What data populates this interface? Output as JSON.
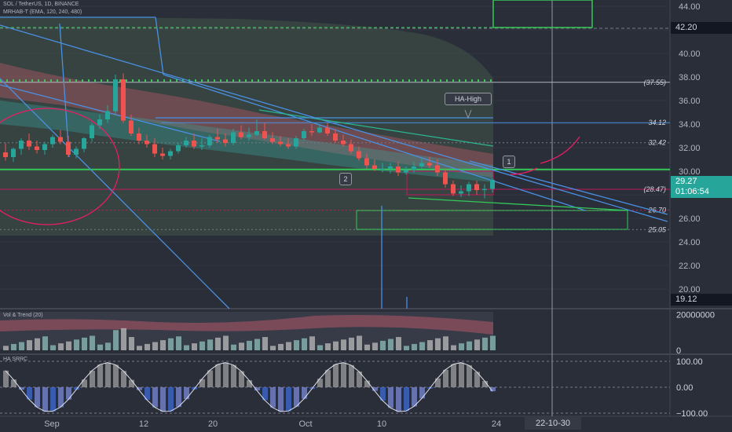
{
  "header": {
    "symbol_line": "SOL / TetherUS, 1D, BINANCE",
    "indicator_line": "MRHAB-T (EMA, 120, 240, 480)"
  },
  "panes": {
    "volume_label": "Vol & Trend (20)",
    "oscillator_label": "HA SRRC"
  },
  "price_labels": {
    "top": "42.20",
    "current_price": "29.27",
    "countdown": "01:06:54",
    "bottom": "19.12"
  },
  "annotations": {
    "ha_high": "HA-High",
    "badge_1": "1",
    "badge_2": "2"
  },
  "crosshair_date": "22-10-30",
  "colors": {
    "background": "#2a2e39",
    "up": "#26a69a",
    "down": "#ef5350",
    "trendline": "#4a90e2",
    "support": "#34c759",
    "crosshair": "#9598a1"
  },
  "chart_data": [
    {
      "type": "line",
      "pane": "price",
      "ylim": [
        18.5,
        44.8
      ],
      "y_ticks": [
        44,
        42,
        40,
        38,
        36,
        34,
        32,
        30,
        28,
        26,
        24,
        22,
        20
      ],
      "x_ticks": [
        "Sep",
        "12",
        "20",
        "Oct",
        "10",
        "24"
      ],
      "level_labels": [
        {
          "value": 37.55,
          "text": "(37.55)"
        },
        {
          "value": 34.12,
          "text": "34.12"
        },
        {
          "value": 32.42,
          "text": "32.42"
        },
        {
          "value": 28.47,
          "text": "(28.47)"
        },
        {
          "value": 26.7,
          "text": "26.70"
        },
        {
          "value": 25.05,
          "text": "25.05"
        }
      ],
      "candles": {
        "dates": [
          "Aug 29",
          "Aug 30",
          "Aug 31",
          "Sep 1",
          "Sep 2",
          "Sep 3",
          "Sep 4",
          "Sep 5",
          "Sep 6",
          "Sep 7",
          "Sep 8",
          "Sep 9",
          "Sep 10",
          "Sep 11",
          "Sep 12",
          "Sep 13",
          "Sep 14",
          "Sep 15",
          "Sep 16",
          "Sep 17",
          "Sep 18",
          "Sep 19",
          "Sep 20",
          "Sep 21",
          "Sep 22",
          "Sep 23",
          "Sep 24",
          "Sep 25",
          "Sep 26",
          "Sep 27",
          "Sep 28",
          "Sep 29",
          "Sep 30",
          "Oct 1",
          "Oct 2",
          "Oct 3",
          "Oct 4",
          "Oct 5",
          "Oct 6",
          "Oct 7",
          "Oct 8",
          "Oct 9",
          "Oct 10",
          "Oct 11",
          "Oct 12",
          "Oct 13",
          "Oct 14",
          "Oct 15",
          "Oct 16",
          "Oct 17",
          "Oct 18",
          "Oct 19",
          "Oct 20",
          "Oct 21",
          "Oct 22",
          "Oct 23",
          "Oct 24",
          "Oct 25",
          "Oct 26",
          "Oct 27",
          "Oct 28",
          "Oct 29",
          "Oct 30"
        ],
        "open": [
          31.6,
          31.2,
          31.9,
          32.6,
          32.1,
          31.8,
          32.3,
          32.9,
          32.5,
          31.4,
          31.9,
          32.8,
          33.9,
          34.4,
          35.1,
          37.8,
          34.3,
          33.2,
          32.6,
          32.3,
          31.5,
          31.3,
          31.7,
          32.2,
          32.6,
          32.1,
          32.2,
          32.9,
          32.7,
          32.4,
          33.3,
          32.9,
          33.1,
          33.4,
          32.8,
          32.5,
          32.3,
          32.1,
          32.8,
          33.4,
          33.3,
          33.7,
          33.2,
          32.6,
          32.3,
          31.7,
          31.1,
          30.5,
          30.2,
          30.2,
          30.4,
          29.9,
          30.1,
          30.4,
          30.7,
          30.5,
          29.9,
          28.9,
          28.1,
          28.3,
          28.9,
          28.4,
          28.5
        ],
        "high": [
          32.4,
          32.0,
          32.8,
          33.2,
          32.6,
          32.5,
          33.1,
          33.5,
          33.0,
          32.1,
          32.9,
          34.1,
          34.8,
          35.6,
          38.2,
          38.3,
          34.8,
          33.7,
          33.1,
          32.8,
          32.0,
          31.9,
          32.4,
          32.9,
          33.2,
          32.8,
          33.1,
          33.6,
          33.2,
          33.6,
          33.9,
          33.7,
          34.4,
          34.1,
          33.3,
          33.0,
          32.8,
          33.0,
          33.6,
          34.0,
          34.0,
          34.1,
          33.6,
          33.1,
          32.7,
          32.1,
          31.5,
          31.0,
          30.7,
          30.7,
          30.8,
          30.4,
          30.8,
          31.1,
          31.2,
          31.0,
          30.2,
          29.2,
          28.8,
          29.1,
          29.2,
          28.9,
          29.4
        ],
        "low": [
          30.9,
          30.8,
          31.4,
          31.8,
          31.5,
          31.4,
          32.0,
          32.3,
          31.2,
          31.1,
          31.6,
          32.5,
          33.6,
          34.1,
          34.8,
          34.1,
          33.0,
          32.3,
          32.0,
          31.2,
          31.0,
          31.0,
          31.5,
          32.0,
          31.9,
          31.8,
          32.0,
          32.4,
          32.1,
          32.2,
          32.7,
          32.6,
          33.0,
          32.7,
          32.3,
          32.1,
          31.9,
          31.9,
          32.6,
          33.0,
          33.2,
          33.0,
          32.4,
          32.1,
          31.5,
          30.9,
          30.2,
          30.0,
          29.9,
          29.8,
          29.6,
          29.7,
          29.9,
          30.2,
          30.3,
          29.6,
          28.6,
          27.9,
          27.8,
          27.9,
          28.0,
          27.7,
          28.2
        ],
        "close": [
          31.2,
          31.9,
          32.6,
          32.1,
          31.8,
          32.3,
          32.9,
          32.5,
          31.4,
          31.9,
          32.8,
          33.9,
          34.4,
          35.1,
          37.8,
          34.3,
          33.2,
          32.6,
          32.3,
          31.5,
          31.3,
          31.7,
          32.2,
          32.6,
          32.1,
          32.2,
          32.9,
          32.7,
          32.4,
          33.3,
          32.9,
          33.1,
          33.4,
          32.8,
          32.5,
          32.3,
          32.1,
          32.8,
          33.4,
          33.3,
          33.7,
          33.2,
          32.6,
          32.3,
          31.7,
          31.1,
          30.5,
          30.2,
          30.2,
          30.4,
          29.9,
          30.1,
          30.4,
          30.7,
          30.5,
          29.9,
          28.9,
          28.1,
          28.3,
          28.9,
          28.4,
          28.5,
          29.27
        ]
      }
    },
    {
      "type": "bar",
      "pane": "volume",
      "title": "Vol & Trend (20)",
      "y_ticks": [
        {
          "value": 20000000,
          "text": "20000000"
        },
        {
          "value": 0,
          "text": "0"
        }
      ],
      "ylim": [
        0,
        22000000
      ]
    },
    {
      "type": "line",
      "pane": "oscillator",
      "title": "HA SRRC",
      "ylim": [
        -115,
        115
      ],
      "y_ticks": [
        {
          "value": 100,
          "text": "100.00"
        },
        {
          "value": 0,
          "text": "0.00"
        },
        {
          "value": -100,
          "text": "−100.00"
        }
      ]
    }
  ]
}
